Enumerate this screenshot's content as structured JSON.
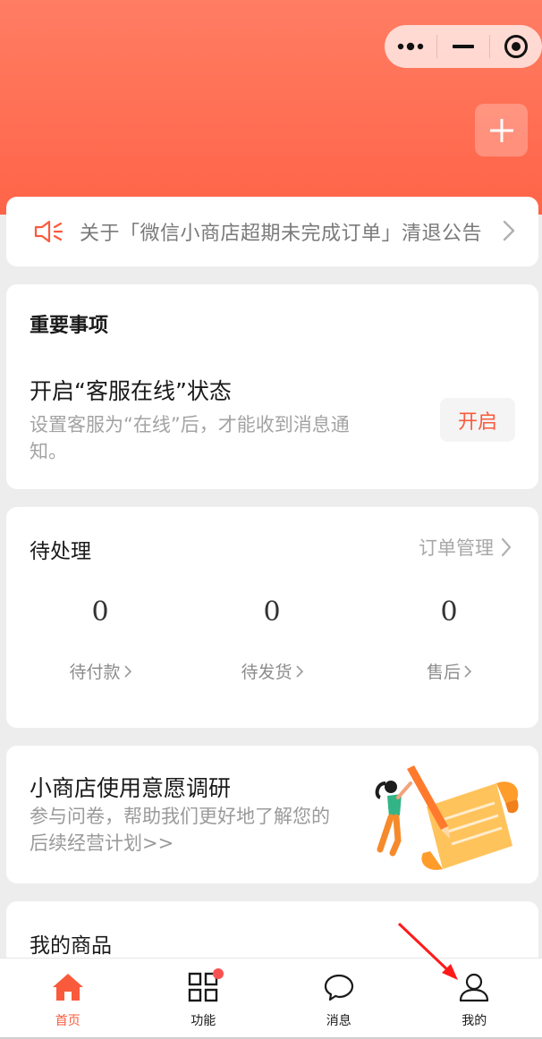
{
  "header": {
    "gradient_top": "#ff7d63",
    "gradient_bottom": "#ff6448",
    "capsule": {
      "more_icon": "more-dots-icon",
      "minimize_icon": "minimize-icon",
      "close_icon": "target-close-icon"
    },
    "add_icon": "plus-icon"
  },
  "notice": {
    "icon": "speaker-icon",
    "text": "关于「微信小商店超期未完成订单」清退公告"
  },
  "important": {
    "title": "重要事项",
    "heading": "开启“客服在线”状态",
    "description": "设置客服为“在线”后，才能收到消息通知。",
    "button_label": "开启"
  },
  "pending": {
    "title": "待处理",
    "link_label": "订单管理",
    "stats": [
      {
        "value": "0",
        "label": "待付款"
      },
      {
        "value": "0",
        "label": "待发货"
      },
      {
        "value": "0",
        "label": "售后"
      }
    ]
  },
  "survey": {
    "title": "小商店使用意愿调研",
    "description": "参与问卷，帮助我们更好地了解您的后续经营计划>>"
  },
  "goods": {
    "title": "我的商品"
  },
  "tabbar": {
    "accent_color": "#fa5a3c",
    "items": [
      {
        "label": "首页",
        "icon": "home-icon",
        "active": true
      },
      {
        "label": "功能",
        "icon": "grid-apps-icon",
        "badge": true
      },
      {
        "label": "消息",
        "icon": "chat-bubble-icon"
      },
      {
        "label": "我的",
        "icon": "user-icon"
      }
    ]
  }
}
